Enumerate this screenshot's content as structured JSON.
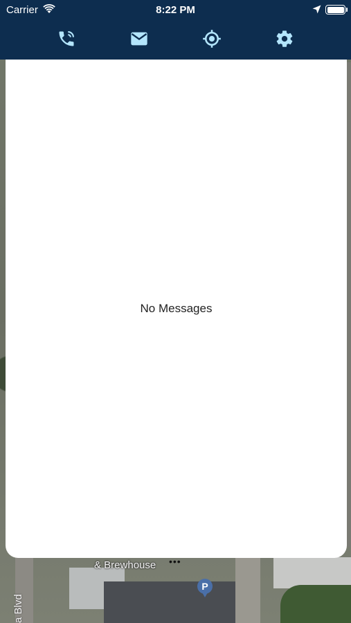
{
  "status_bar": {
    "carrier": "Carrier",
    "time": "8:22 PM"
  },
  "toolbar": {
    "items": [
      {
        "icon": "phone-call-icon"
      },
      {
        "icon": "mail-icon"
      },
      {
        "icon": "location-target-icon"
      },
      {
        "icon": "gear-icon"
      }
    ],
    "icon_color": "#b3e5fc",
    "background": "#0d2d4f"
  },
  "messages": {
    "empty_text": "No Messages"
  },
  "map": {
    "labels": {
      "poi": "& Brewhouse",
      "street": "a Blvd"
    },
    "pin_label": "P"
  }
}
